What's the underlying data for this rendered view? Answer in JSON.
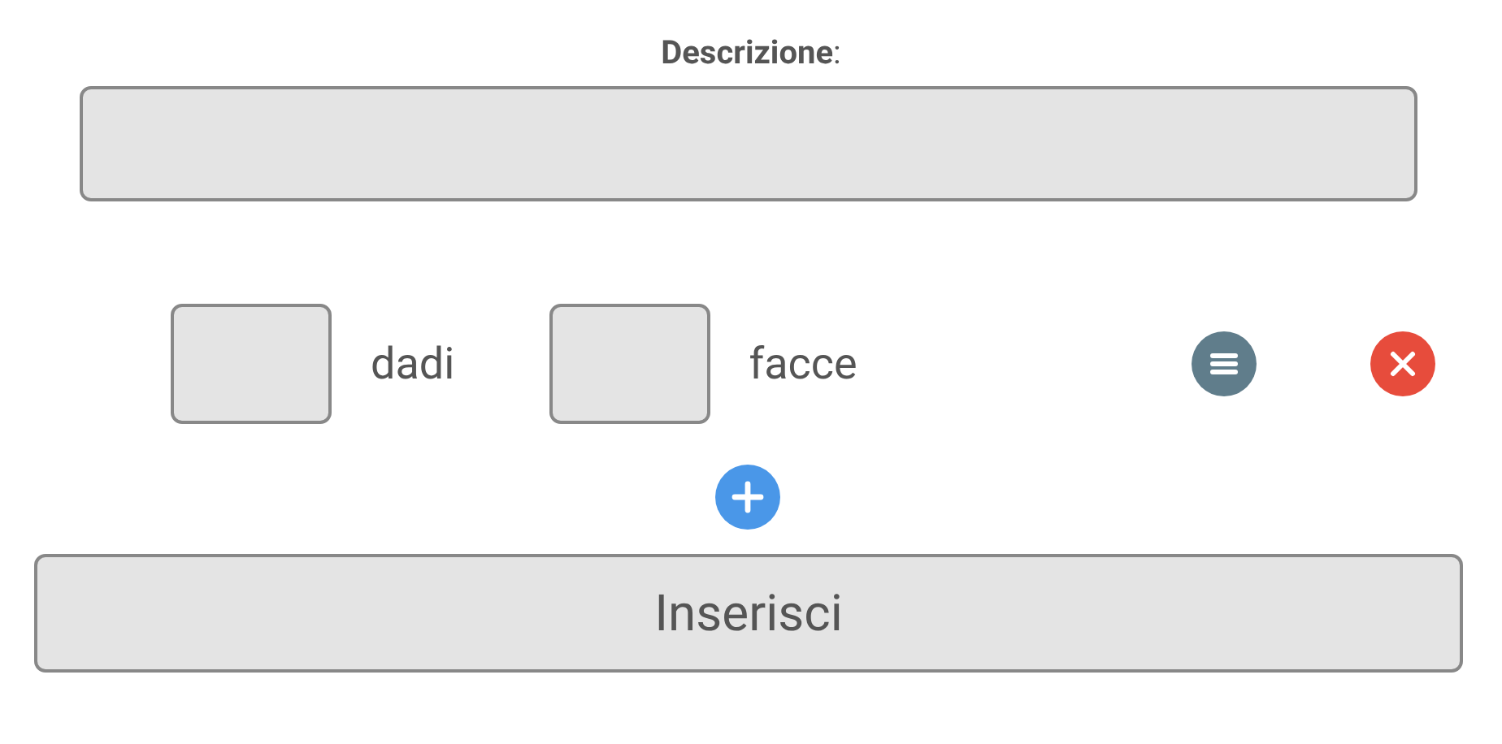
{
  "description": {
    "label": "**Descrizione**:"
  },
  "dice_row": {
    "fields": [
      {
        "unit": "dadi"
      },
      {
        "unit": "facce"
      }
    ]
  },
  "submit_button": {
    "label": "Inserisci"
  }
}
